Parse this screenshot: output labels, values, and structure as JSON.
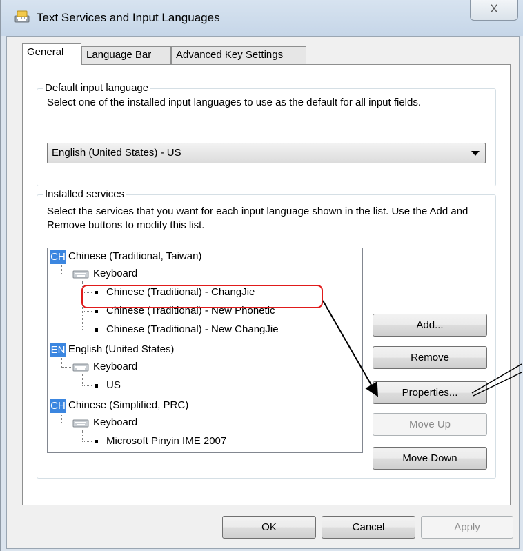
{
  "window": {
    "title": "Text Services and Input Languages",
    "close_label": "X"
  },
  "tabs": [
    {
      "label": "General",
      "active": true
    },
    {
      "label": "Language Bar",
      "active": false
    },
    {
      "label": "Advanced Key Settings",
      "active": false
    }
  ],
  "default_input": {
    "group_label": "Default input language",
    "description": "Select one of the installed input languages to use as the default for all input fields.",
    "selected": "English (United States) - US"
  },
  "installed_services": {
    "group_label": "Installed services",
    "description": "Select the services that you want for each input language shown in the list. Use the Add and Remove buttons to modify this list.",
    "tree": {
      "lang1": {
        "badge": "CH",
        "name": "Chinese (Traditional, Taiwan)"
      },
      "lang1_keyboard": "Keyboard",
      "lang1_items": [
        "Chinese (Traditional) - ChangJie",
        "Chinese (Traditional) - New Phonetic",
        "Chinese (Traditional) - New ChangJie"
      ],
      "lang2": {
        "badge": "EN",
        "name": "English (United States)"
      },
      "lang2_keyboard": "Keyboard",
      "lang2_items": [
        "US"
      ],
      "lang3": {
        "badge": "CH",
        "name": "Chinese (Simplified, PRC)"
      },
      "lang3_keyboard": "Keyboard",
      "lang3_items": [
        "Microsoft Pinyin IME 2007"
      ]
    },
    "buttons": {
      "add": "Add...",
      "remove": "Remove",
      "properties": "Properties...",
      "move_up": "Move Up",
      "move_down": "Move Down"
    }
  },
  "footer": {
    "ok": "OK",
    "cancel": "Cancel",
    "apply": "Apply"
  },
  "colors": {
    "badge": "#3b86e0",
    "highlight": "#e01b1b",
    "titlebar": "#c6d6e8"
  }
}
